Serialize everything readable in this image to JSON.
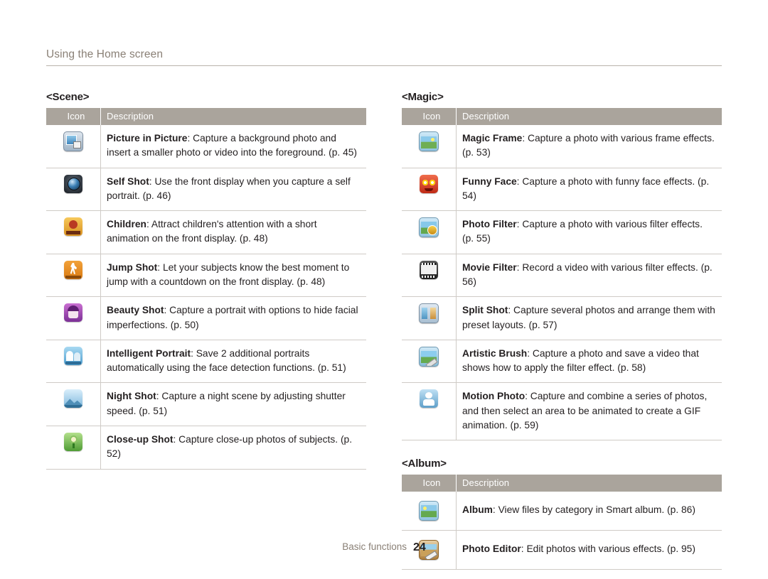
{
  "header": {
    "title": "Using the Home screen"
  },
  "sections": [
    {
      "title": "<Scene>",
      "columns": {
        "icon": "Icon",
        "description": "Description"
      },
      "rows": [
        {
          "icon": "picture-in-picture-icon",
          "name": "Picture in Picture",
          "text": ": Capture a background photo and insert a smaller photo or video into the foreground. (p. 45)"
        },
        {
          "icon": "self-shot-icon",
          "name": "Self Shot",
          "text": ": Use the front display when you capture a self portrait. (p. 46)"
        },
        {
          "icon": "children-icon",
          "name": "Children",
          "text": ": Attract children's attention with a short animation on the front display. (p. 48)"
        },
        {
          "icon": "jump-shot-icon",
          "name": "Jump Shot",
          "text": ": Let your subjects know the best moment to jump with a countdown on the front display. (p. 48)"
        },
        {
          "icon": "beauty-shot-icon",
          "name": "Beauty Shot",
          "text": ": Capture a portrait with options to hide facial imperfections. (p. 50)"
        },
        {
          "icon": "intelligent-portrait-icon",
          "name": "Intelligent Portrait",
          "text": ": Save 2 additional portraits automatically using the face detection functions. (p. 51)"
        },
        {
          "icon": "night-shot-icon",
          "name": "Night Shot",
          "text": ": Capture a night scene by adjusting shutter speed. (p. 51)"
        },
        {
          "icon": "close-up-shot-icon",
          "name": "Close-up Shot",
          "text": ": Capture close-up photos of subjects. (p. 52)"
        }
      ]
    },
    {
      "title": "<Magic>",
      "columns": {
        "icon": "Icon",
        "description": "Description"
      },
      "rows": [
        {
          "icon": "magic-frame-icon",
          "name": "Magic Frame",
          "text": ": Capture a photo with various frame effects. (p. 53)"
        },
        {
          "icon": "funny-face-icon",
          "name": "Funny Face",
          "text": ": Capture a photo with funny face effects. (p. 54)"
        },
        {
          "icon": "photo-filter-icon",
          "name": "Photo Filter",
          "text": ": Capture a photo with various filter effects. (p. 55)"
        },
        {
          "icon": "movie-filter-icon",
          "name": "Movie Filter",
          "text": ": Record a video with various filter effects. (p. 56)"
        },
        {
          "icon": "split-shot-icon",
          "name": "Split Shot",
          "text": ": Capture several photos and arrange them with preset layouts. (p. 57)"
        },
        {
          "icon": "artistic-brush-icon",
          "name": "Artistic Brush",
          "text": ": Capture a photo and save a video that shows how to apply the filter effect. (p. 58)"
        },
        {
          "icon": "motion-photo-icon",
          "name": "Motion Photo",
          "text": ": Capture and combine a series of photos, and then select an area to be animated to create a GIF animation. (p. 59)"
        }
      ]
    },
    {
      "title": "<Album>",
      "columns": {
        "icon": "Icon",
        "description": "Description"
      },
      "rows": [
        {
          "icon": "album-icon",
          "name": "Album",
          "text": ": View files by category in Smart album. (p. 86)"
        },
        {
          "icon": "photo-editor-icon",
          "name": "Photo Editor",
          "text": ": Edit photos with various effects. (p. 95)"
        }
      ]
    }
  ],
  "footer": {
    "label": "Basic functions",
    "page_number": "24"
  }
}
